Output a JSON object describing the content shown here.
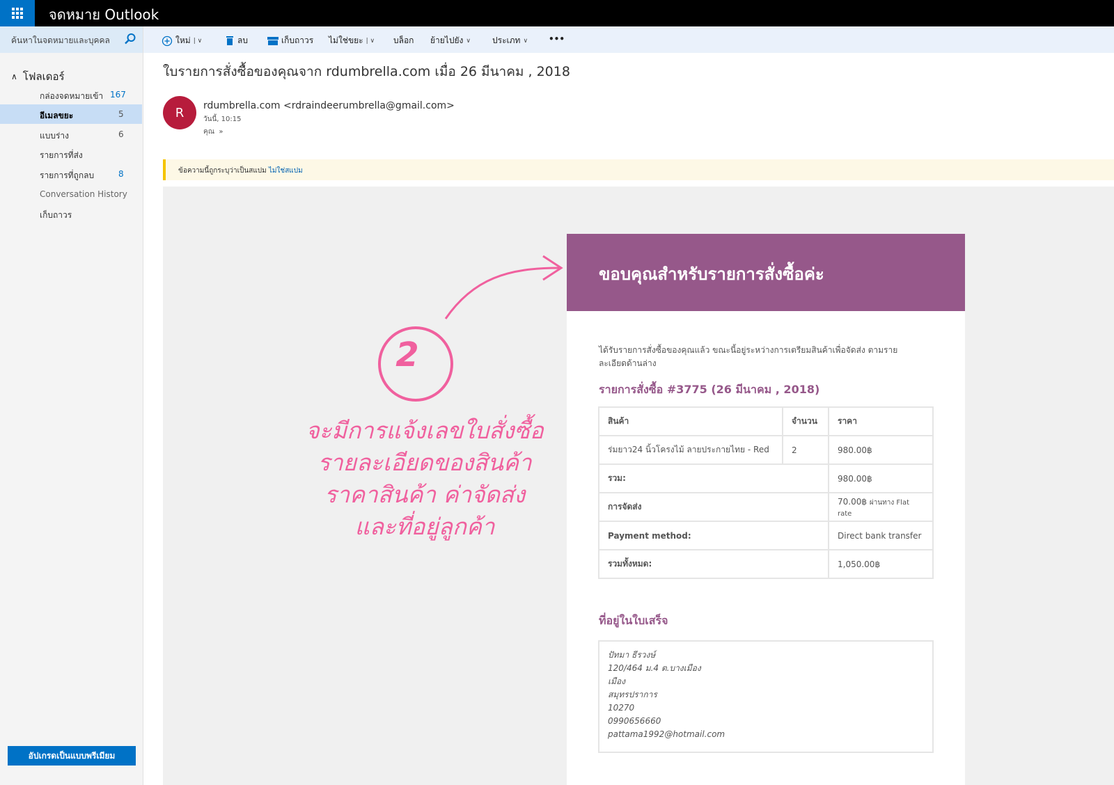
{
  "app": {
    "title": "จดหมาย Outlook"
  },
  "search": {
    "placeholder": "ค้นหาในจดหมายและบุคคล"
  },
  "toolbar": {
    "new_label": "ใหม่",
    "delete_label": "ลบ",
    "archive_label": "เก็บถาวร",
    "not_junk_label": "ไม่ใช่ขยะ",
    "block_label": "บล็อก",
    "move_label": "ย้ายไปยัง",
    "category_label": "ประเภท",
    "more_label": "•••"
  },
  "sidebar": {
    "header": "โฟลเดอร์",
    "items": [
      {
        "label": "กล่องจดหมายเข้า",
        "count": "167"
      },
      {
        "label": "อีเมลขยะ",
        "count": "5"
      },
      {
        "label": "แบบร่าง",
        "count": "6"
      },
      {
        "label": "รายการที่ส่ง",
        "count": ""
      },
      {
        "label": "รายการที่ถูกลบ",
        "count": "8"
      },
      {
        "label": "Conversation History",
        "count": ""
      },
      {
        "label": "เก็บถาวร",
        "count": ""
      }
    ],
    "upgrade_label": "อัปเกรดเป็นแบบพรีเมียม"
  },
  "message": {
    "subject": "ใบรายการสั่งซื้อของคุณจาก rdumbrella.com เมื่อ 26 มีนาคม , 2018",
    "avatar_initial": "R",
    "sender": "rdumbrella.com <rdraindeerumbrella@gmail.com>",
    "date": "วันนี้, 10:15",
    "to": "คุณ",
    "spam_notice": "ข้อความนี้ถูกระบุว่าเป็นสแปม",
    "spam_link": "ไม่ใช่สแปม"
  },
  "email": {
    "header_title": "ขอบคุณสำหรับรายการสั่งซื้อค่ะ",
    "intro": "ได้รับรายการสั่งซื้อของคุณแล้ว ขณะนี้อยู่ระหว่างการเตรียมสินค้าเพื่อจัดส่ง ตามรายละเอียดด้านล่าง",
    "order_heading": "รายการสั่งซื้อ #3775 (26 มีนาคม , 2018)",
    "columns": [
      "สินค้า",
      "จำนวน",
      "ราคา"
    ],
    "item": {
      "name": "ร่มยาว24 นิ้วโครงไม้ ลายประกายไทย - Red",
      "qty": "2",
      "price": "980.00฿"
    },
    "subtotal": {
      "label": "รวม:",
      "value": "980.00฿"
    },
    "shipping": {
      "label": "การจัดส่ง",
      "value": "70.00฿",
      "note": "ผ่านทาง Flat rate"
    },
    "payment": {
      "label": "Payment method:",
      "value": "Direct bank transfer"
    },
    "total": {
      "label": "รวมทั้งหมด:",
      "value": "1,050.00฿"
    },
    "address_heading": "ที่อยู่ในใบเสร็จ",
    "address": [
      "ปัทมา ธีรวงษ์",
      "120/464 ม.4 ต.บางเมือง",
      "เมือง",
      "สมุทรปราการ",
      "10270",
      "0990656660",
      "pattama1992@hotmail.com"
    ]
  },
  "annotation": {
    "number": "2",
    "lines": [
      "จะมีการแจ้งเลขใบสั่งซื้อ",
      "รายละเอียดของสินค้า",
      "ราคาสินค้า ค่าจัดส่ง",
      "และที่อยู่ลูกค้า"
    ]
  },
  "colors": {
    "brand": "#0072c6",
    "accent": "#96588a",
    "annotation": "#f0609e",
    "avatar": "#b71c3c"
  }
}
